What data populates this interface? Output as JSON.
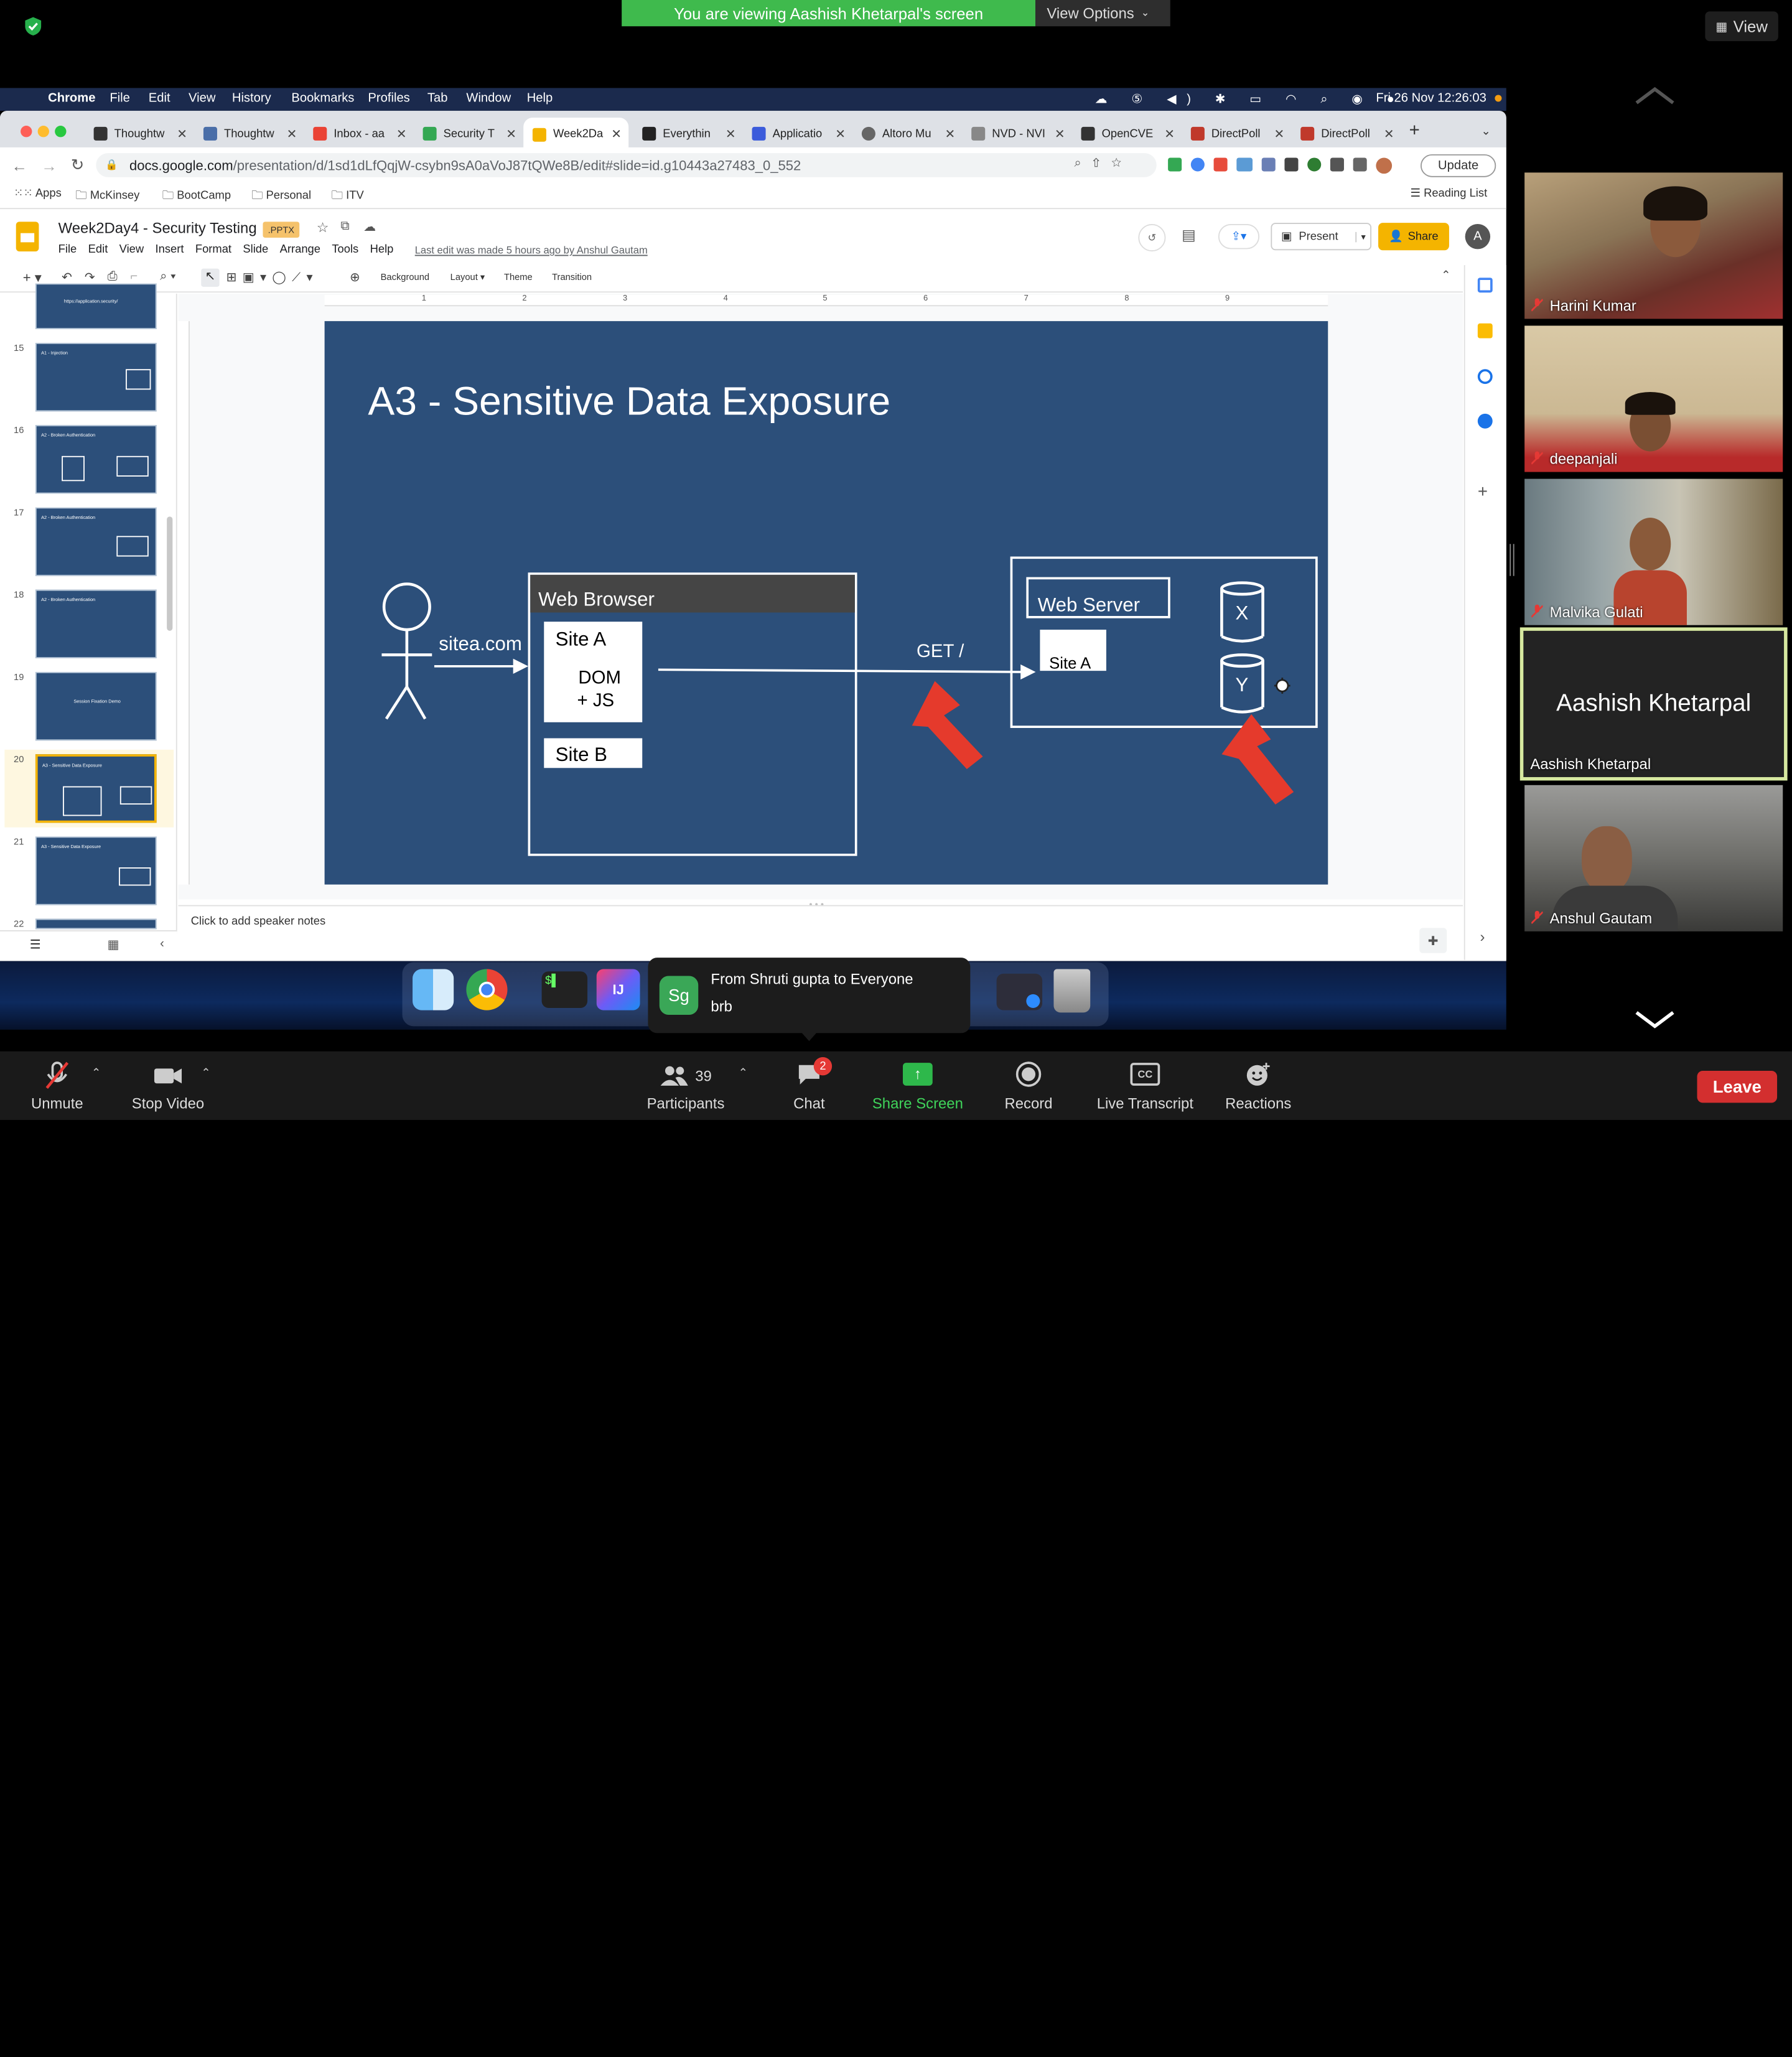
{
  "zoom_top": {
    "banner": "You are viewing Aashish Khetarpal's screen",
    "view_options": "View Options",
    "view_button": "View"
  },
  "mac_menu": {
    "app": "Chrome",
    "items": [
      "File",
      "Edit",
      "View",
      "History",
      "Bookmarks",
      "Profiles",
      "Tab",
      "Window",
      "Help"
    ],
    "datetime": "Fri 26 Nov  12:26:03"
  },
  "tabs": [
    "Thoughtw",
    "Thoughtw",
    "Inbox - aa",
    "Security T",
    "Week2Da",
    "Everythin",
    "Applicatio",
    "Altoro Mu",
    "NVD - NVI",
    "OpenCVE",
    "DirectPoll",
    "DirectPoll"
  ],
  "url": {
    "host": "docs.google.com",
    "path": "/presentation/d/1sd1dLfQqjW-csybn9sA0aVoJ87tQWe8B/edit#slide=id.g10443a27483_0_552"
  },
  "update_label": "Update",
  "bookmarks": [
    "Apps",
    "McKinsey",
    "BootCamp",
    "Personal",
    "ITV"
  ],
  "reading_list": "Reading List",
  "doc": {
    "title": "Week2Day4 - Security Testing",
    "badge": ".PPTX",
    "menus": [
      "File",
      "Edit",
      "View",
      "Insert",
      "Format",
      "Slide",
      "Arrange",
      "Tools",
      "Help"
    ],
    "last_edit": "Last edit was made 5 hours ago by Anshul Gautam",
    "present": "Present",
    "share": "Share",
    "avatar": "A"
  },
  "toolbar": {
    "background": "Background",
    "layout": "Layout",
    "theme": "Theme",
    "transition": "Transition"
  },
  "ruler": [
    "1",
    "2",
    "3",
    "4",
    "5",
    "6",
    "7",
    "8",
    "9"
  ],
  "filmstrip": [
    {
      "num": "",
      "title": "https://application.security/"
    },
    {
      "num": "15",
      "title": "A1 - Injection"
    },
    {
      "num": "16",
      "title": "A2 - Broken Authentication"
    },
    {
      "num": "17",
      "title": "A2 - Broken Authentication"
    },
    {
      "num": "18",
      "title": "A2 - Broken Authentication"
    },
    {
      "num": "19",
      "title": "Session Fixation Demo"
    },
    {
      "num": "20",
      "title": "A3 - Sensitive Data Exposure"
    },
    {
      "num": "21",
      "title": "A3 - Sensitive Data Exposure"
    },
    {
      "num": "22",
      "title": ""
    }
  ],
  "slide": {
    "title": "A3  - Sensitive Data Exposure",
    "domain_label": "sitea.com",
    "browser": "Web Browser",
    "site_a": "Site A",
    "dom_js_1": "DOM",
    "dom_js_2": "+ JS",
    "site_b": "Site B",
    "get": "GET /",
    "server": "Web Server",
    "server_site_a": "Site A",
    "db_x": "X",
    "db_y": "Y"
  },
  "speaker_notes": "Click to add speaker notes",
  "dock_chat": {
    "initials": "Sg",
    "from": "From Shruti gupta to Everyone",
    "message": "brb"
  },
  "participants": [
    {
      "name": "Harini Kumar"
    },
    {
      "name": "deepanjali"
    },
    {
      "name": "Malvika Gulati"
    },
    {
      "name": "Aashish Khetarpal"
    },
    {
      "name": "Anshul Gautam"
    }
  ],
  "zoom_bar": {
    "unmute": "Unmute",
    "stop_video": "Stop Video",
    "participants": "Participants",
    "participants_count": "39",
    "chat": "Chat",
    "chat_badge": "2",
    "share_screen": "Share Screen",
    "record": "Record",
    "live_transcript": "Live Transcript",
    "reactions": "Reactions",
    "leave": "Leave"
  },
  "colors": {
    "slide_bg": "#2c4f7a",
    "arrow_red": "#e53a2c",
    "zoom_green": "#3fba4d",
    "leave_red": "#d32f2f",
    "share_green": "#2eb84b"
  }
}
